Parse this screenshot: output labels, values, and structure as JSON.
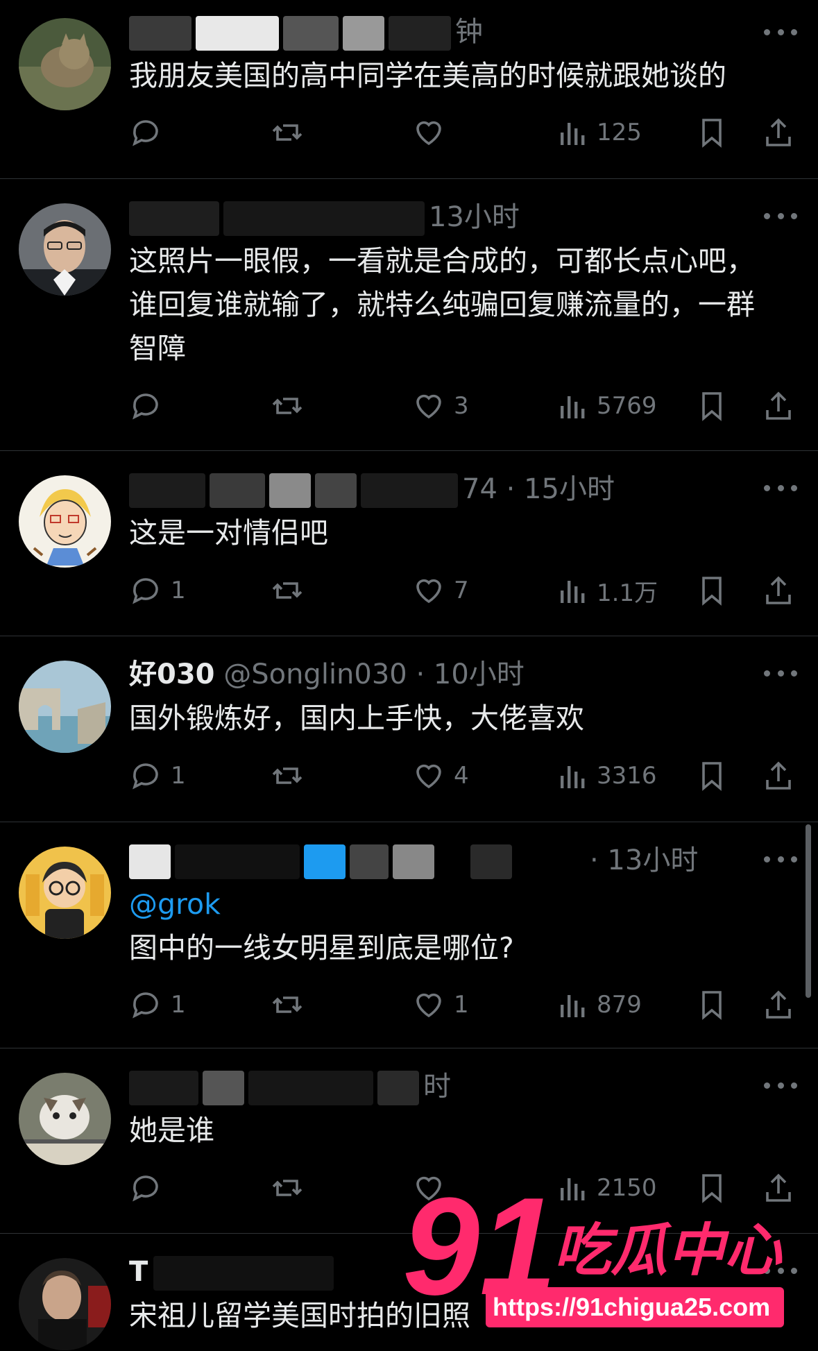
{
  "colors": {
    "background": "#000000",
    "text": "#e7e9ea",
    "muted": "#71767b",
    "link": "#1d9bf0",
    "divider": "#2f3336",
    "watermark": "#ff2a6d"
  },
  "icons": {
    "reply": "reply-icon",
    "repost": "repost-icon",
    "like": "heart-icon",
    "views": "views-icon",
    "bookmark": "bookmark-icon",
    "share": "share-icon",
    "more": "more-icon"
  },
  "tweets": [
    {
      "name": "",
      "handle": "",
      "time": "钟",
      "text": "我朋友美国的高中同学在美高的时候就跟她谈的",
      "mention": "",
      "replies": "",
      "likes": "",
      "views": "125"
    },
    {
      "name": "",
      "handle": "",
      "time": "13小时",
      "text": "这照片一眼假，一看就是合成的，可都长点心吧，谁回复谁就输了，就特么纯骗回复赚流量的，一群智障",
      "mention": "",
      "replies": "",
      "likes": "3",
      "views": "5769"
    },
    {
      "name": "",
      "handle": "",
      "time": "74 · 15小时",
      "text": "这是一对情侣吧",
      "mention": "",
      "replies": "1",
      "likes": "7",
      "views": "1.1万"
    },
    {
      "name": "好030",
      "handle": "@Songlin030",
      "time": "· 10小时",
      "text": "国外锻炼好，国内上手快，大佬喜欢",
      "mention": "",
      "replies": "1",
      "likes": "4",
      "views": "3316"
    },
    {
      "name": "",
      "handle": "",
      "time": "· 13小时",
      "text": "图中的一线女明星到底是哪位?",
      "mention": "@grok",
      "replies": "1",
      "likes": "1",
      "views": "879"
    },
    {
      "name": "",
      "handle": "",
      "time": "时",
      "text": "她是谁",
      "mention": "",
      "replies": "",
      "likes": "",
      "views": "2150"
    },
    {
      "name": "T",
      "handle": "",
      "time": "",
      "text": "宋祖儿留学美国时拍的旧照",
      "mention": "",
      "replies": "",
      "likes": "",
      "views": ""
    }
  ],
  "watermark": {
    "number": "91",
    "brand": "吃瓜中心",
    "url": "https://91chigua25.com"
  }
}
